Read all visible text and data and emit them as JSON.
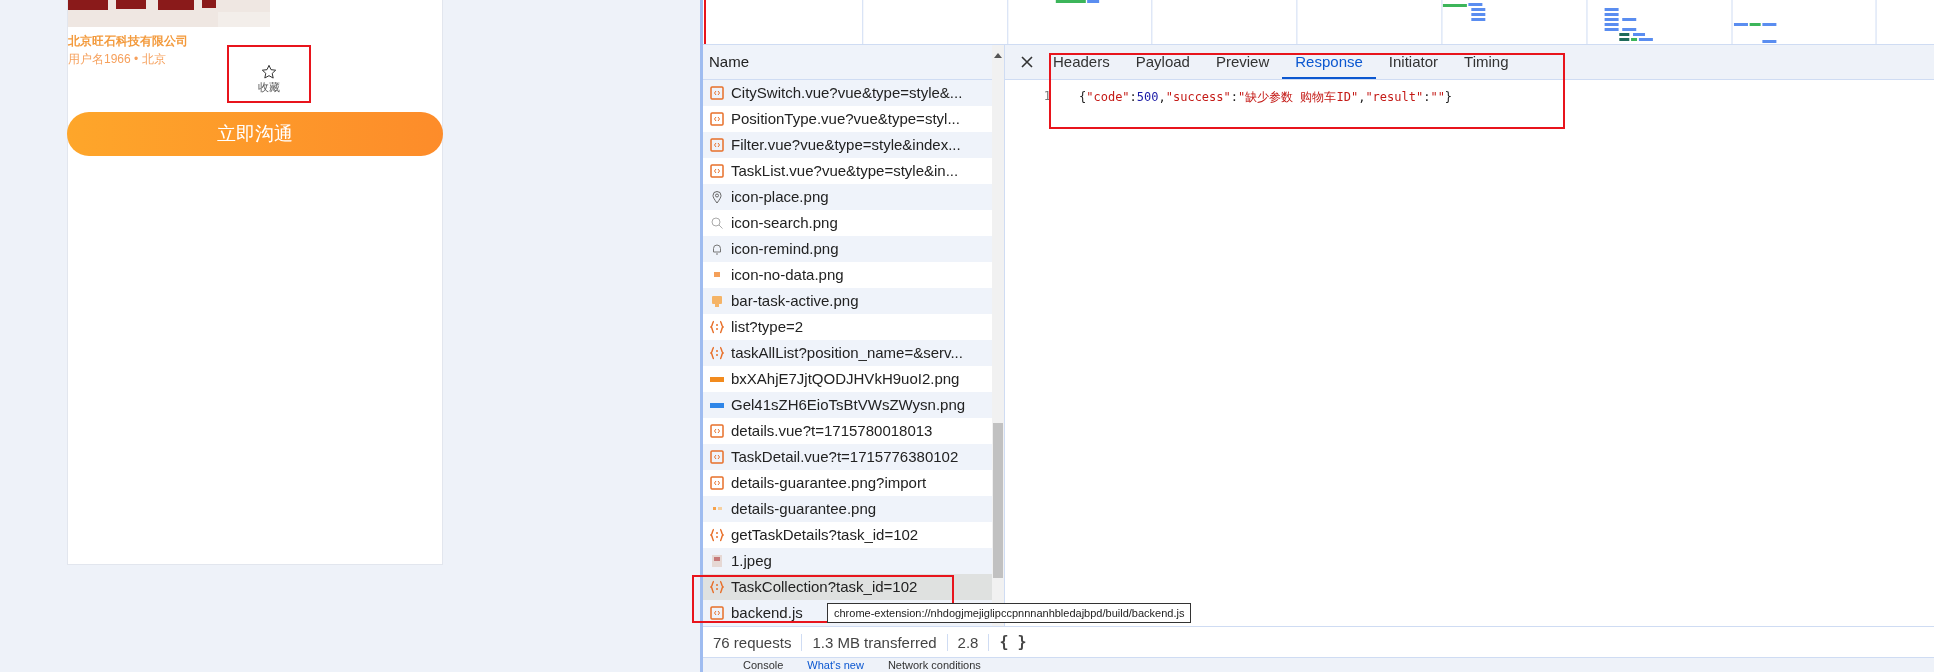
{
  "phone": {
    "company": "北京旺石科技有限公司",
    "user": "用户名1966 • 北京",
    "favorite": {
      "label": "收藏",
      "checked": false,
      "highlighted": true
    },
    "cta": "立即沟通"
  },
  "devtools": {
    "name_column": "Name",
    "requests": [
      {
        "name": "CitySwitch.vue?vue&type=style&...",
        "kind": "script",
        "selected": false
      },
      {
        "name": "PositionType.vue?vue&type=styl...",
        "kind": "script",
        "selected": false
      },
      {
        "name": "Filter.vue?vue&type=style&index...",
        "kind": "script",
        "selected": false
      },
      {
        "name": "TaskList.vue?vue&type=style&in...",
        "kind": "script",
        "selected": false
      },
      {
        "name": "icon-place.png",
        "kind": "pin",
        "selected": false
      },
      {
        "name": "icon-search.png",
        "kind": "search",
        "selected": false
      },
      {
        "name": "icon-remind.png",
        "kind": "bell",
        "selected": false
      },
      {
        "name": "icon-no-data.png",
        "kind": "thumb",
        "selected": false
      },
      {
        "name": "bar-task-active.png",
        "kind": "monitor",
        "selected": false
      },
      {
        "name": "list?type=2",
        "kind": "fetch",
        "selected": false
      },
      {
        "name": "taskAllList?position_name=&serv...",
        "kind": "fetch",
        "selected": false
      },
      {
        "name": "bxXAhjE7JjtQODJHVkH9uoI2.png",
        "kind": "banner-orange",
        "selected": false
      },
      {
        "name": "Gel41sZH6EioTsBtVWsZWysn.png",
        "kind": "banner-blue",
        "selected": false
      },
      {
        "name": "details.vue?t=1715780018013",
        "kind": "script",
        "selected": false
      },
      {
        "name": "TaskDetail.vue?t=1715776380102",
        "kind": "script",
        "selected": false
      },
      {
        "name": "details-guarantee.png?import",
        "kind": "script",
        "selected": false
      },
      {
        "name": "details-guarantee.png",
        "kind": "dots",
        "selected": false
      },
      {
        "name": "getTaskDetails?task_id=102",
        "kind": "fetch",
        "selected": false
      },
      {
        "name": "1.jpeg",
        "selected": false
      },
      {
        "name": "TaskCollection?task_id=102",
        "kind": "fetch",
        "selected": true,
        "highlighted": true
      },
      {
        "name": "backend.js",
        "kind": "script",
        "selected": false
      }
    ],
    "tabs": [
      {
        "label": "Headers",
        "selected": false
      },
      {
        "label": "Payload",
        "selected": false
      },
      {
        "label": "Preview",
        "selected": false
      },
      {
        "label": "Response",
        "selected": true
      },
      {
        "label": "Initiator",
        "selected": false
      },
      {
        "label": "Timing",
        "selected": false
      }
    ],
    "response": {
      "line_number": "1",
      "tokens": [
        {
          "text": "{"
        },
        {
          "text": "\"code\"",
          "color": "#c41a16"
        },
        {
          "text": ":"
        },
        {
          "text": "500",
          "color": "#1a1aa6"
        },
        {
          "text": ","
        },
        {
          "text": "\"success\"",
          "color": "#c41a16"
        },
        {
          "text": ":"
        },
        {
          "text": "\"缺少参数 购物车ID\"",
          "color": "#c41a16"
        },
        {
          "text": ","
        },
        {
          "text": "\"result\"",
          "color": "#c41a16"
        },
        {
          "text": ":"
        },
        {
          "text": "\"\"",
          "color": "#c41a16"
        },
        {
          "text": "}"
        }
      ]
    },
    "tooltip": "chrome-extension://nhdogjmejiglipccpnnnanhbledajbpd/build/backend.js",
    "status": [
      "76 requests",
      "1.3 MB transferred",
      "2.8"
    ],
    "pretty_print": "{ }",
    "drawer_tabs": [
      {
        "label": "Console",
        "selected": false
      },
      {
        "label": "What's new",
        "selected": true
      },
      {
        "label": "Network conditions",
        "selected": false
      }
    ]
  }
}
